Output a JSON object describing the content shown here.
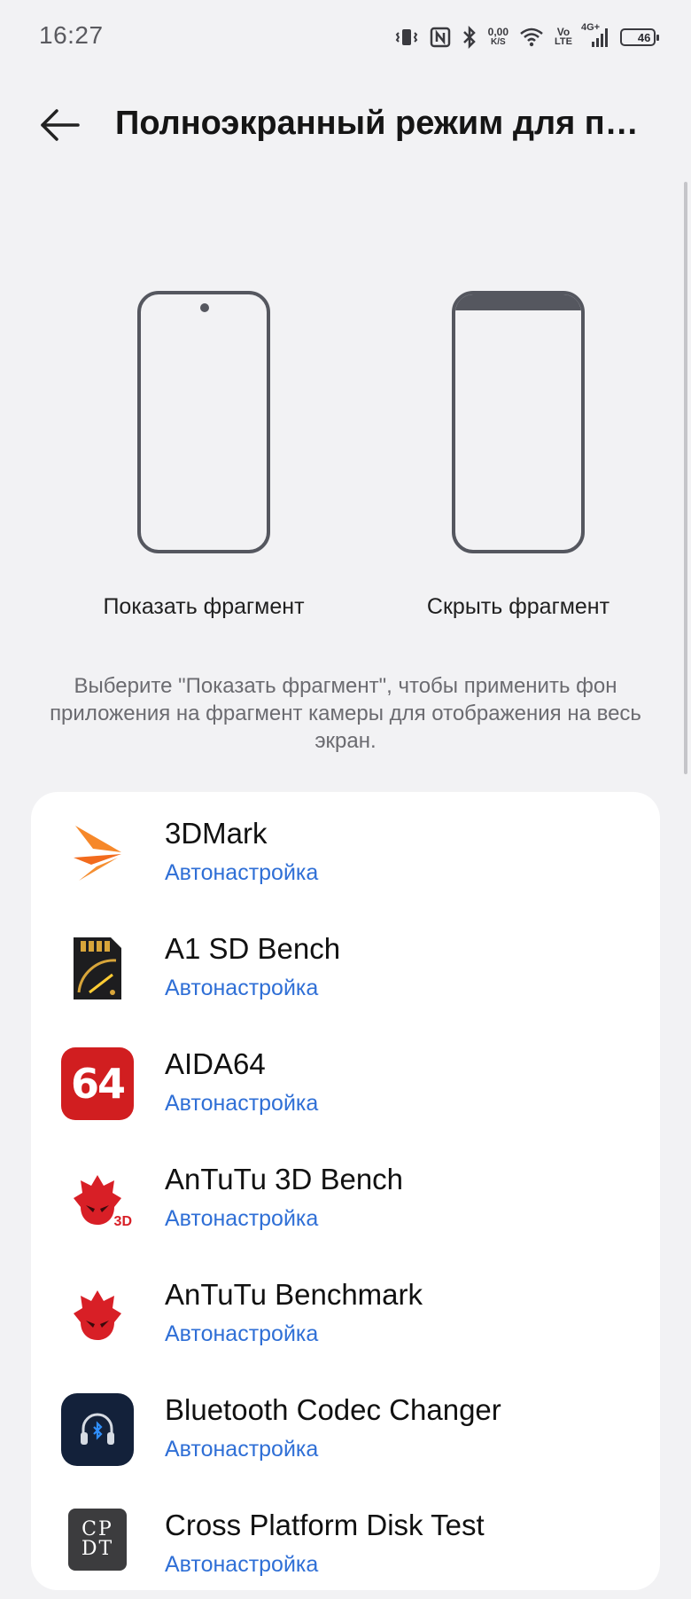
{
  "status_bar": {
    "time": "16:27",
    "data_speed_value": "0,00",
    "data_speed_unit": "K/S",
    "volte_top": "Vo",
    "volte_bottom": "LTE",
    "network": "4G+",
    "battery": "46",
    "battery_level_percent": 46
  },
  "header": {
    "title": "Полноэкранный режим для пр..."
  },
  "options": {
    "show_label": "Показать фрагмент",
    "hide_label": "Скрыть фрагмент"
  },
  "description": "Выберите \"Показать фрагмент\", чтобы применить фон приложения на фрагмент камеры для отображения на весь экран.",
  "apps": [
    {
      "name": "3DMark",
      "status": "Автонастройка",
      "icon": "3dmark-icon"
    },
    {
      "name": "A1 SD Bench",
      "status": "Автонастройка",
      "icon": "a1-sd-bench-icon"
    },
    {
      "name": "AIDA64",
      "status": "Автонастройка",
      "icon": "aida64-icon",
      "icon_text": "64"
    },
    {
      "name": "AnTuTu 3D Bench",
      "status": "Автонастройка",
      "icon": "antutu-3d-icon",
      "icon_text": "3D"
    },
    {
      "name": "AnTuTu Benchmark",
      "status": "Автонастройка",
      "icon": "antutu-icon"
    },
    {
      "name": "Bluetooth Codec Changer",
      "status": "Автонастройка",
      "icon": "bluetooth-codec-icon"
    },
    {
      "name": "Cross Platform Disk Test",
      "status": "Автонастройка",
      "icon": "cpdt-icon",
      "icon_text_top": "CP",
      "icon_text_bottom": "DT"
    }
  ],
  "colors": {
    "background": "#f2f2f4",
    "accent": "#2f6fd6",
    "card": "#ffffff"
  }
}
